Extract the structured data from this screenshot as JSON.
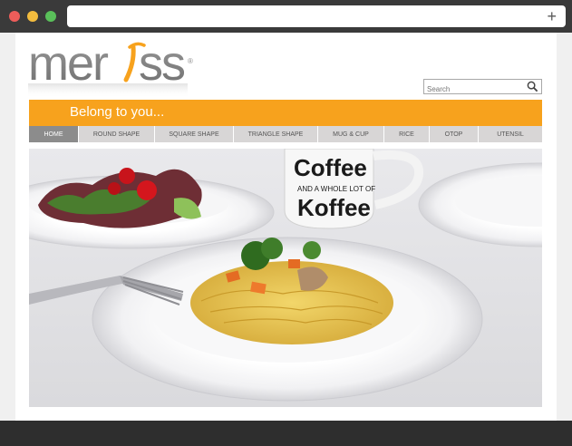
{
  "browser": {
    "new_tab_label": "+"
  },
  "brand": {
    "logo_text": "mer",
    "logo_text_end": "ss",
    "registered_mark": "®",
    "accent": "#f7a21d"
  },
  "search": {
    "placeholder": "Search"
  },
  "banner": {
    "tagline": "Belong to you..."
  },
  "nav": {
    "items": [
      {
        "label": "HOME"
      },
      {
        "label": "ROUND SHAPE"
      },
      {
        "label": "SQUARE SHAPE"
      },
      {
        "label": "TRIANGLE SHAPE"
      },
      {
        "label": "MUG & CUP"
      },
      {
        "label": "RICE"
      },
      {
        "label": "OTOP"
      },
      {
        "label": "UTENSIL"
      }
    ]
  },
  "hero": {
    "mug_line1": "Coffee",
    "mug_line2": "AND A WHOLE LOT OF",
    "mug_line3": "Koffee"
  }
}
